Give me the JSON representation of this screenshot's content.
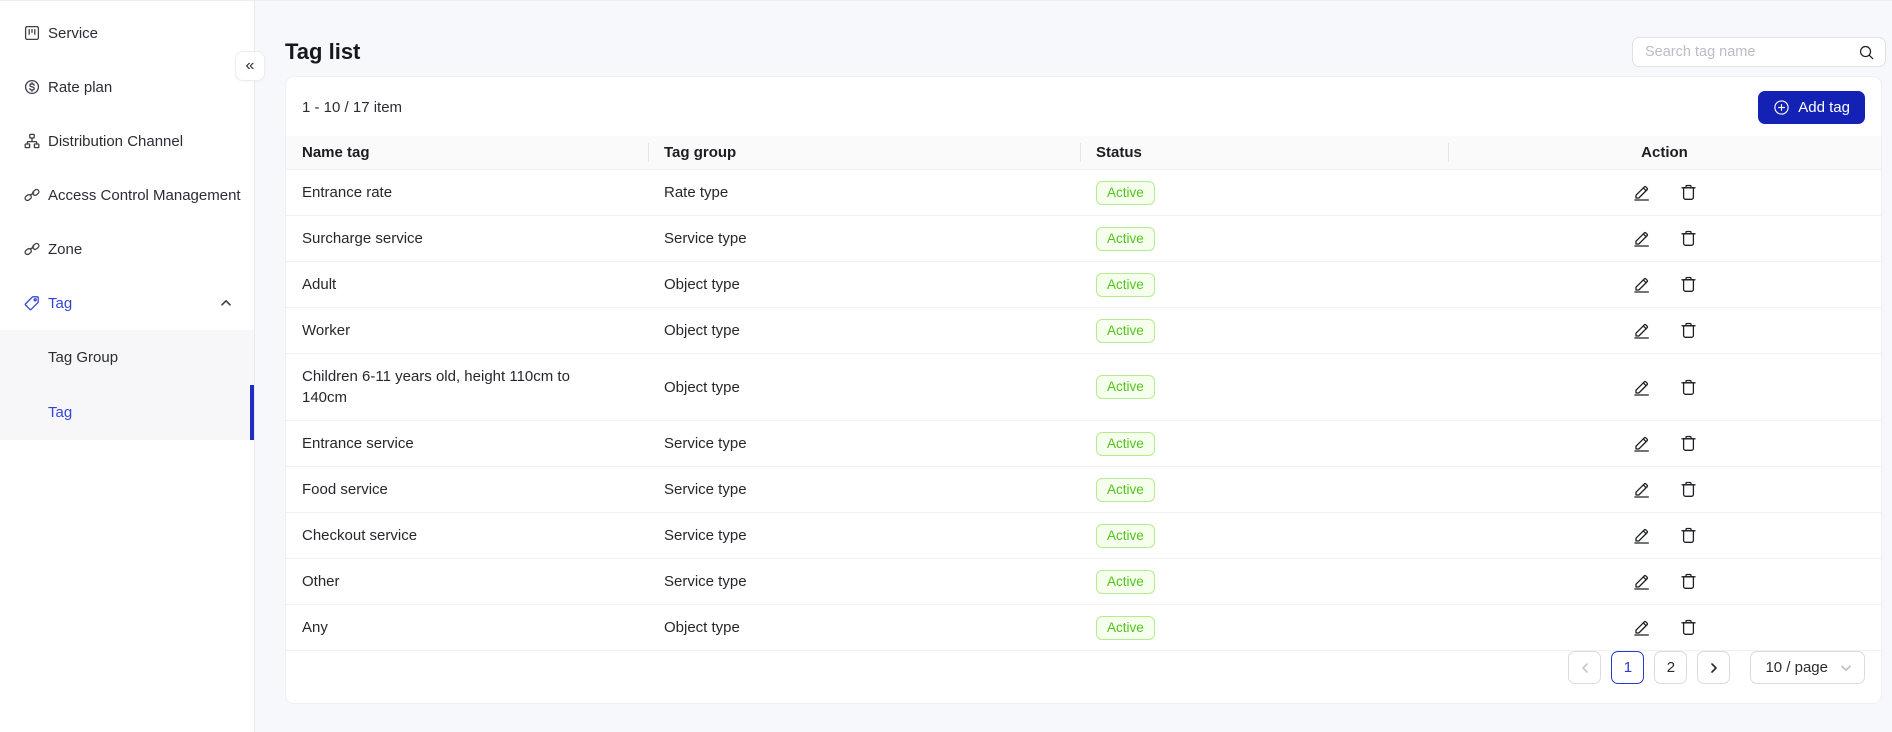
{
  "sidebar": {
    "collapse_glyph": "«",
    "items": [
      {
        "label": "Service",
        "icon": "service",
        "active": false,
        "expanded": false
      },
      {
        "label": "Rate plan",
        "icon": "dollar-circle",
        "active": false,
        "expanded": false
      },
      {
        "label": "Distribution Channel",
        "icon": "sitemap",
        "active": false,
        "expanded": false
      },
      {
        "label": "Access Control Management",
        "icon": "chain-link",
        "active": false,
        "expanded": false
      },
      {
        "label": "Zone",
        "icon": "chain-link",
        "active": false,
        "expanded": false
      },
      {
        "label": "Tag",
        "icon": "tag",
        "active": true,
        "expanded": true
      }
    ],
    "submenu": [
      {
        "label": "Tag Group",
        "active": false
      },
      {
        "label": "Tag",
        "active": true
      }
    ]
  },
  "header": {
    "title": "Tag list",
    "search_placeholder": "Search tag name"
  },
  "toolbar": {
    "count_text": "1 - 10 / 17 item",
    "add_button_label": "Add tag"
  },
  "table": {
    "columns": [
      "Name tag",
      "Tag group",
      "Status",
      "Action"
    ],
    "rows": [
      {
        "name": "Entrance rate",
        "group": "Rate type",
        "status": "Active"
      },
      {
        "name": "Surcharge service",
        "group": "Service type",
        "status": "Active"
      },
      {
        "name": "Adult",
        "group": "Object type",
        "status": "Active"
      },
      {
        "name": "Worker",
        "group": "Object type",
        "status": "Active"
      },
      {
        "name": "Children 6-11 years old, height 110cm to 140cm",
        "group": "Object type",
        "status": "Active"
      },
      {
        "name": "Entrance service",
        "group": "Service type",
        "status": "Active"
      },
      {
        "name": "Food service",
        "group": "Service type",
        "status": "Active"
      },
      {
        "name": "Checkout service",
        "group": "Service type",
        "status": "Active"
      },
      {
        "name": "Other",
        "group": "Service type",
        "status": "Active"
      },
      {
        "name": "Any",
        "group": "Object type",
        "status": "Active"
      }
    ]
  },
  "pagination": {
    "pages": [
      "1",
      "2"
    ],
    "active_page": "1",
    "page_size": "10 / page"
  },
  "colors": {
    "accent_blue": "#1321b4",
    "active_link_blue": "#3544d8",
    "active_indicator_blue": "#1f2ec0",
    "pagination_active_blue": "#2a39cc",
    "badge_green_text": "#52c41a",
    "badge_green_border": "#b7eb8f",
    "badge_green_bg": "#f6ffed",
    "page_bg": "#f7f8fc",
    "table_header_bg": "#fafafa"
  }
}
